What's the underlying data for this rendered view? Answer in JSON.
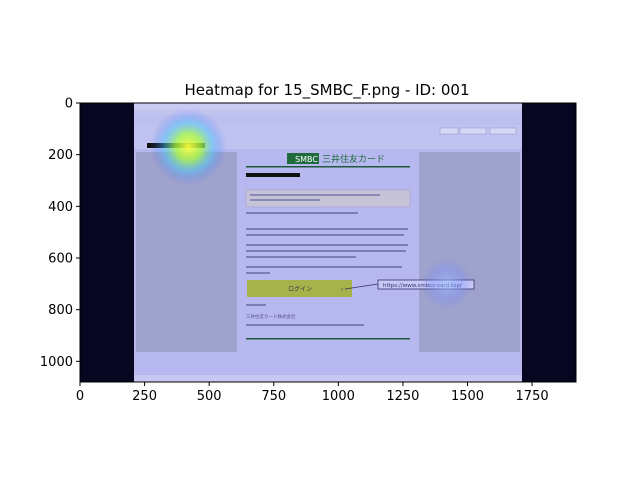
{
  "chart_data": {
    "type": "heatmap",
    "title": "Heatmap for 15_SMBC_F.png - ID: 001",
    "xlabel": "",
    "ylabel": "",
    "xlim": [
      0,
      1920
    ],
    "ylim": [
      1080,
      0
    ],
    "xticks": [
      0,
      250,
      500,
      750,
      1000,
      1250,
      1500,
      1750
    ],
    "yticks": [
      0,
      200,
      400,
      600,
      800,
      1000
    ],
    "grid": false,
    "hotspots": [
      {
        "x": 420,
        "y": 170,
        "intensity": 1.0
      },
      {
        "x": 1420,
        "y": 700,
        "intensity": 0.6
      }
    ]
  },
  "screenshot": {
    "colors": {
      "overlay": "#b6b8ef",
      "letterbox": "#060620",
      "login_button": "#a6b34a",
      "brand_green": "#1e6b3c",
      "side_panel": "#9fa2cc"
    },
    "email": {
      "brand": "SMBC",
      "brand_name": "三井住友カード",
      "login_label": "ログイン",
      "link_tooltip": "https://www.smbcc-card.top/",
      "sender_footer": "三井住友カード株式会社"
    }
  }
}
